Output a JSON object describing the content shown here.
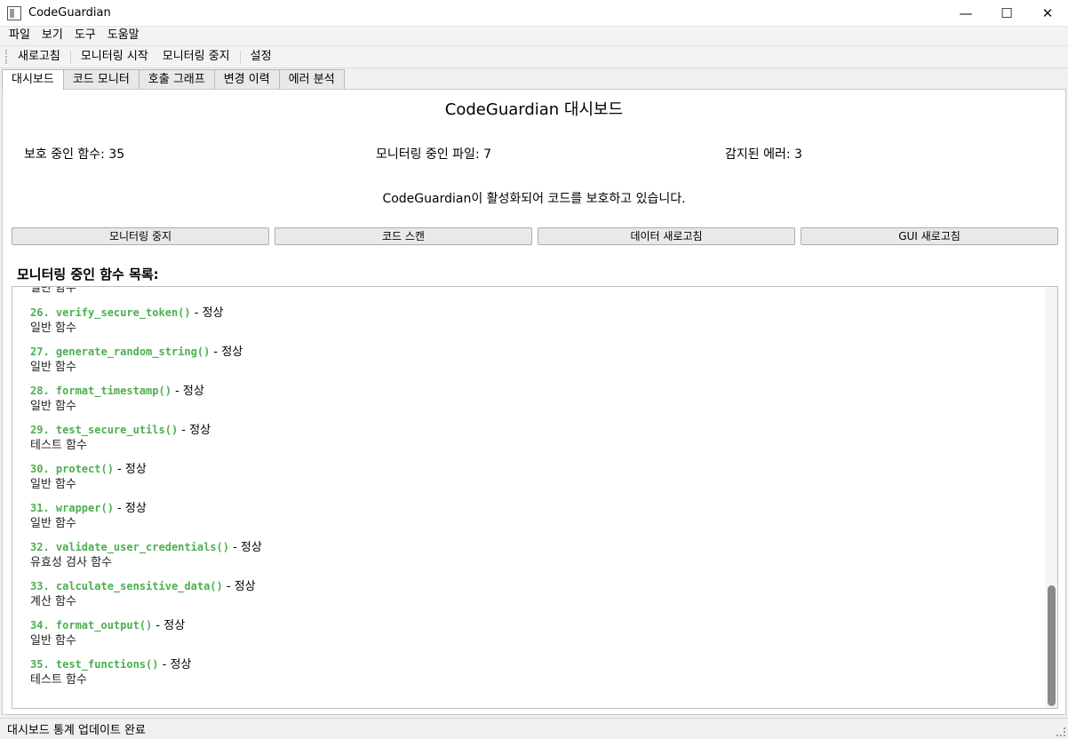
{
  "window": {
    "title": "CodeGuardian",
    "minimize": "—",
    "maximize": "☐",
    "close": "✕"
  },
  "menu": [
    "파일",
    "보기",
    "도구",
    "도움말"
  ],
  "toolbar": [
    "새로고침",
    "모니터링 시작",
    "모니터링 중지",
    "설정"
  ],
  "tabs": [
    "대시보드",
    "코드 모니터",
    "호출 그래프",
    "변경 이력",
    "에러 분석"
  ],
  "dashboard": {
    "title": "CodeGuardian 대시보드",
    "stats": [
      "보호 중인 함수: 35",
      "모니터링 중인 파일: 7",
      "감지된 에러: 3"
    ],
    "status_message": "CodeGuardian이 활성화되어 코드를 보호하고 있습니다.",
    "buttons": [
      "모니터링 중지",
      "코드 스캔",
      "데이터 새로고침",
      "GUI 새로고침"
    ],
    "list_heading": "모니터링 중인 함수 목록:",
    "partial_top_desc": "일반 함수",
    "functions": [
      {
        "name": "26. verify_secure_token()",
        "status": " - 정상",
        "desc": "일반 함수"
      },
      {
        "name": "27. generate_random_string()",
        "status": " - 정상",
        "desc": "일반 함수"
      },
      {
        "name": "28. format_timestamp()",
        "status": " - 정상",
        "desc": "일반 함수"
      },
      {
        "name": "29. test_secure_utils()",
        "status": " - 정상",
        "desc": "테스트 함수"
      },
      {
        "name": "30. protect()",
        "status": " - 정상",
        "desc": "일반 함수"
      },
      {
        "name": "31. wrapper()",
        "status": " - 정상",
        "desc": "일반 함수"
      },
      {
        "name": "32. validate_user_credentials()",
        "status": " - 정상",
        "desc": "유효성 검사 함수"
      },
      {
        "name": "33. calculate_sensitive_data()",
        "status": " - 정상",
        "desc": "계산 함수"
      },
      {
        "name": "34. format_output()",
        "status": " - 정상",
        "desc": "일반 함수"
      },
      {
        "name": "35. test_functions()",
        "status": " - 정상",
        "desc": "테스트 함수"
      }
    ]
  },
  "statusbar": {
    "text": "대시보드 통계 업데이트 완료"
  },
  "colors": {
    "function_name": "#4caf50"
  }
}
